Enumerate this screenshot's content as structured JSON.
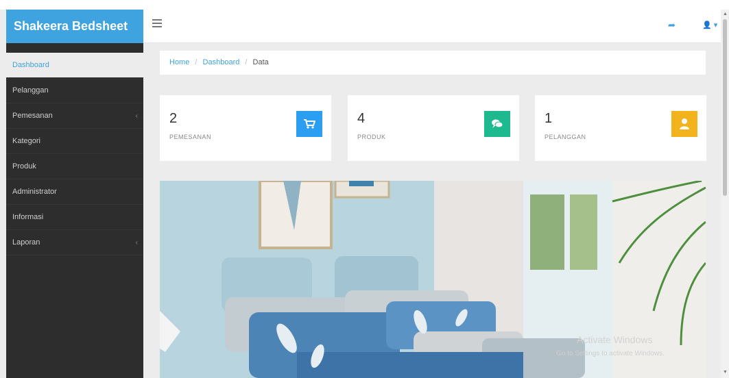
{
  "app": {
    "brand": "Shakeera Bedsheet"
  },
  "navbar": {
    "menu_icon": "hamburger-icon",
    "share_icon": "share-icon",
    "user_icon": "user-icon"
  },
  "sidebar": {
    "items": [
      {
        "label": "Dashboard",
        "active": true
      },
      {
        "label": "Pelanggan"
      },
      {
        "label": "Pemesanan",
        "has_submenu": true
      },
      {
        "label": "Kategori"
      },
      {
        "label": "Produk"
      },
      {
        "label": "Administrator"
      },
      {
        "label": "Informasi"
      },
      {
        "label": "Laporan",
        "has_submenu": true
      }
    ],
    "caret": "‹"
  },
  "breadcrumb": {
    "home": "Home",
    "dashboard": "Dashboard",
    "current": "Data",
    "separator": "/"
  },
  "stats": [
    {
      "value": "2",
      "label": "PEMESANAN",
      "icon": "shopping-cart-icon",
      "color": "#2b9ef2"
    },
    {
      "value": "4",
      "label": "PRODUK",
      "icon": "comments-icon",
      "color": "#1fb990"
    },
    {
      "value": "1",
      "label": "PELANGGAN",
      "icon": "user-icon",
      "color": "#f2b31d"
    }
  ],
  "banner": {
    "subject": "bedroom-photo"
  },
  "watermark": {
    "line1": "Activate Windows",
    "line2": "Go to Settings to activate Windows."
  },
  "colors": {
    "brand": "#3fa3df",
    "sidebar": "#2d2d2d",
    "content_bg": "#ececec"
  }
}
